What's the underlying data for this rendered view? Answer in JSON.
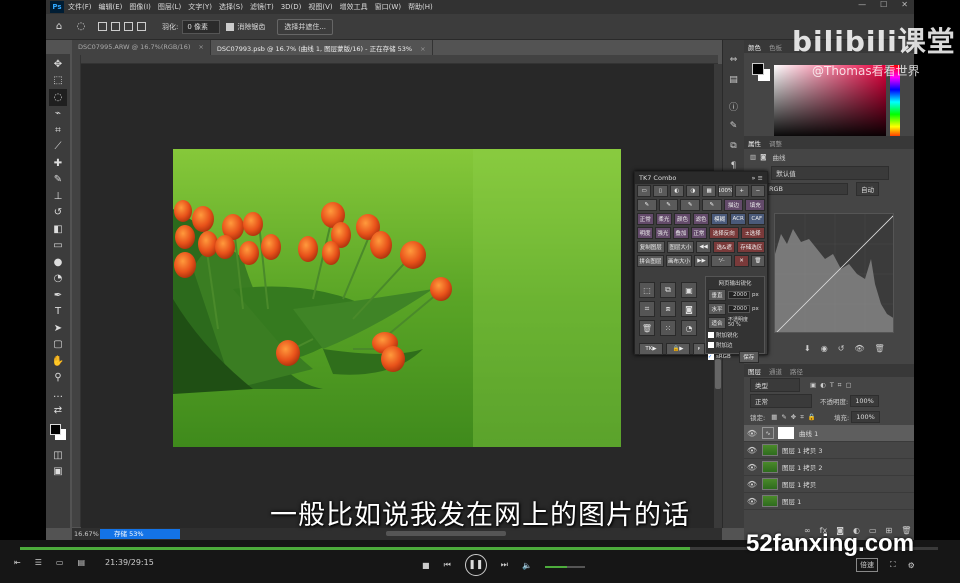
{
  "menubar": {
    "app_icon": "Ps",
    "items": [
      "文件(F)",
      "编辑(E)",
      "图像(I)",
      "图层(L)",
      "文字(Y)",
      "选择(S)",
      "滤镜(T)",
      "3D(D)",
      "视图(V)",
      "增效工具",
      "窗口(W)",
      "帮助(H)"
    ]
  },
  "options": {
    "feather_label": "羽化:",
    "feather_value": "0 像素",
    "antialias_label": "消除锯齿",
    "select_mask_btn": "选择并遮住..."
  },
  "tabs": [
    {
      "label": "DSC07995.ARW @ 16.7%(RGB/16)",
      "close": "×"
    },
    {
      "label": "DSC07993.psb @ 16.7% (曲线 1, 图层蒙版/16) - 正在存储 53%",
      "close": "×"
    }
  ],
  "statusbar": {
    "zoom": "16.67%",
    "progress": "存储 53%",
    "progress_value": 0.53
  },
  "tk7": {
    "title": "TK7 Combo",
    "pct": "100%",
    "row2": [
      "描边",
      "填充"
    ],
    "row3": [
      "正常",
      "柔光",
      "颜色",
      "滤色",
      "模糊",
      "ACR",
      "CAF"
    ],
    "row4": [
      "明度",
      "强光",
      "叠加",
      "正常",
      "选择反向",
      "±选择"
    ],
    "row5": [
      "复制图层",
      "图层大小",
      "选&遮",
      "存储选区"
    ],
    "row6": [
      "拼合图层",
      "画布大小"
    ],
    "export_title": "网页输出锐化",
    "vertical_label": "垂直",
    "vertical_value": "2000",
    "horizontal_label": "水平",
    "horizontal_value": "2000",
    "unit": "px",
    "fit_label": "适合",
    "opacity_label": "不透明度",
    "opacity_value": "50",
    "opacity_unit": "%",
    "sharpen_label": "附加锐化",
    "add_border_label": "附加边",
    "srgb_label": "sRGB",
    "save_label": "保存",
    "tk_btn": "TK"
  },
  "color_panel": {
    "tab1": "颜色",
    "tab2": "色板"
  },
  "properties": {
    "tab1": "属性",
    "tab2": "调整",
    "type_label": "曲线",
    "preset_label": "预设:",
    "preset_value": "默认值",
    "channel_value": "RGB",
    "auto_btn": "自动"
  },
  "layers": {
    "tab1": "图层",
    "tab2": "通道",
    "tab3": "路径",
    "filter_value": "类型",
    "blend_value": "正常",
    "opacity_label": "不透明度:",
    "opacity_value": "100%",
    "lock_label": "锁定:",
    "fill_label": "填充:",
    "fill_value": "100%",
    "items": [
      {
        "name": "曲线 1",
        "type": "adjustment",
        "selected": true
      },
      {
        "name": "图层 1 拷贝 3"
      },
      {
        "name": "图层 1 拷贝 2"
      },
      {
        "name": "图层 1 拷贝"
      },
      {
        "name": "图层 1"
      }
    ]
  },
  "player": {
    "time": "21:39/29:15",
    "progress": 0.73,
    "speed_btn": "倍速",
    "volume": 0.55
  },
  "subtitle": "一般比如说我发在网上的图片的话",
  "watermark": {
    "logo": "bilibili课堂",
    "user": "@Thomas看看世界",
    "site": "52fanxing.com"
  }
}
